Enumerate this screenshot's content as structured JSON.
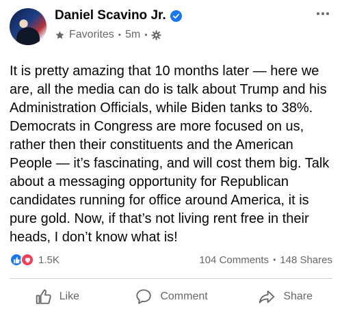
{
  "post": {
    "author": "Daniel Scavino Jr.",
    "audience": "Favorites",
    "time": "5m",
    "body": "It is pretty amazing that 10 months later — here we are, all the media can do is talk about Trump and his Administration Officials, while Biden tanks to 38%. Democrats in Congress are more focused on us, rather then their constituents and the American People — it’s fascinating, and will cost them big. Talk about a messaging opportunity for Republican candidates running for office around America, it is pure gold. Now, if that’s not living rent free in their heads, I don’t know what is!"
  },
  "stats": {
    "reaction_count": "1.5K",
    "comments": "104 Comments",
    "separator": "•",
    "shares": "148 Shares"
  },
  "actions": {
    "like": "Like",
    "comment": "Comment",
    "share": "Share"
  },
  "icons": {
    "verified": "verified-badge-icon",
    "audience": "star-icon",
    "privacy": "gear-icon",
    "more": "more-horizontal-icon",
    "like_reaction": "thumbs-up-icon",
    "love_reaction": "heart-icon"
  },
  "colors": {
    "facebook_blue": "#1877f2",
    "love_red": "#f33e58",
    "secondary_text": "#65676b"
  }
}
